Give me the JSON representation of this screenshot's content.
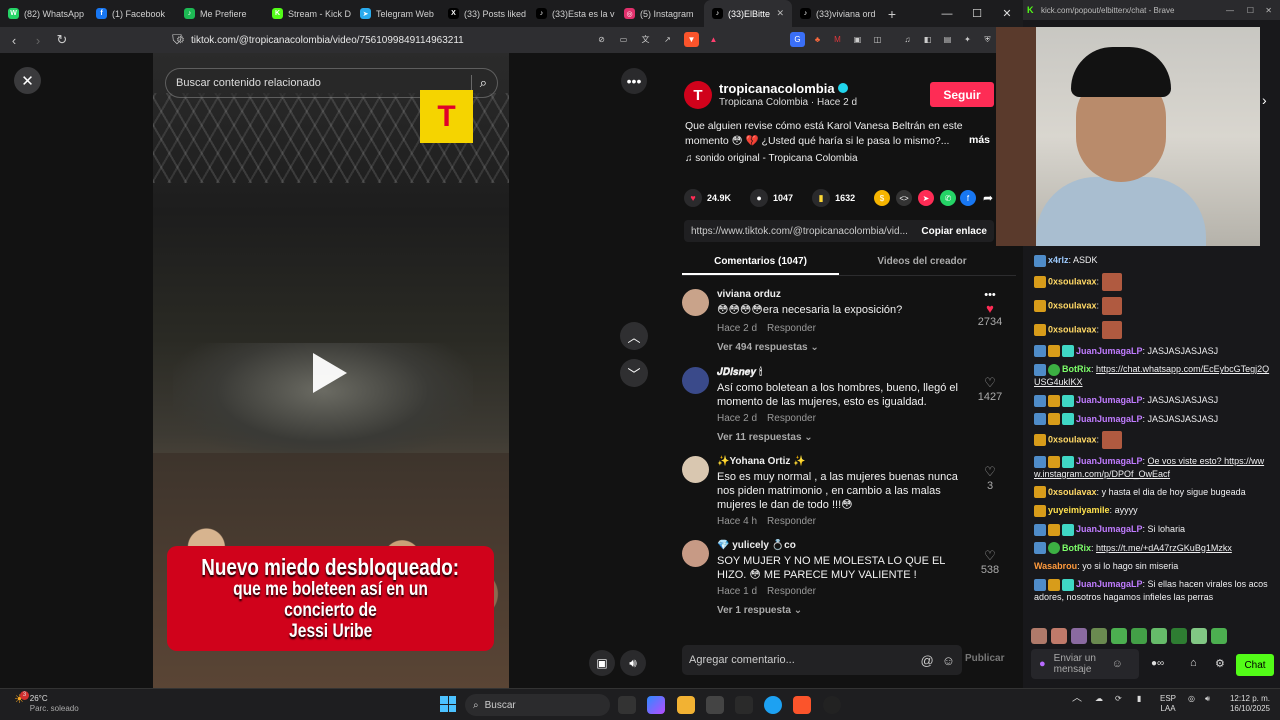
{
  "browser": {
    "tabs": [
      {
        "label": "(82) WhatsApp",
        "color": "#25d366",
        "glyph": "W"
      },
      {
        "label": "(1) Facebook",
        "color": "#1877f2",
        "glyph": "f"
      },
      {
        "label": "Me Prefiere",
        "color": "#1db954",
        "glyph": "♪"
      },
      {
        "label": "Stream - Kick D",
        "color": "#53fc18",
        "glyph": "K"
      },
      {
        "label": "Telegram Web",
        "color": "#2aabee",
        "glyph": "➤"
      },
      {
        "label": "(33) Posts liked",
        "color": "#000000",
        "glyph": "X"
      },
      {
        "label": "(33)Esta es la v",
        "color": "#000000",
        "glyph": "♪"
      },
      {
        "label": "(5) Instagram",
        "color": "#e1306c",
        "glyph": "◎"
      },
      {
        "label": "(33)ElBitte",
        "color": "#000000",
        "glyph": "♪"
      },
      {
        "label": "(33)viviana ord",
        "color": "#000000",
        "glyph": "♪"
      }
    ],
    "url": "tiktok.com/@tropicanacolombia/video/7561099849114963211"
  },
  "video": {
    "search_placeholder": "Buscar contenido relacionado",
    "logo_letter": "T",
    "caption_line1": "Nuevo miedo desbloqueado:",
    "caption_line2": "que me boleteen así en un concierto de",
    "caption_line3": "Jessi Uribe"
  },
  "post": {
    "avatar_letter": "T",
    "username": "tropicanacolombia",
    "subtitle": "Tropicana Colombia · Hace 2 d",
    "follow_label": "Seguir",
    "description": "Que alguien revise cómo está Karol Vanesa Beltrán en este momento 😳 💔 ¿Usted qué haría si le pasa lo mismo?...",
    "more_label": "más",
    "sound": "♫  sonido original - Tropicana Colombia",
    "likes": "24.9K",
    "comments": "1047",
    "saves": "1632",
    "link": "https://www.tiktok.com/@tropicanacolombia/vid...",
    "copy_label": "Copiar enlace",
    "tab_comments": "Comentarios (1047)",
    "tab_videos": "Videos del creador",
    "comment_placeholder": "Agregar comentario...",
    "publish_label": "Publicar"
  },
  "comments": [
    {
      "name": "viviana orduz",
      "text": "😳😳😳😳era necesaria la exposición?",
      "time": "Hace 2 d",
      "reply": "Responder",
      "replies": "Ver 494 respuestas ⌄",
      "likes": "2734",
      "liked": true,
      "avatar": "#c9a38a"
    },
    {
      "name": "𝑱𝑫𝒊𝒔𝒏𝒆𝒚 🕯",
      "text": "Así como boletean a los hombres, bueno, llegó el momento de las mujeres, esto es igualdad.",
      "time": "Hace 2 d",
      "reply": "Responder",
      "replies": "Ver 11 respuestas ⌄",
      "likes": "1427",
      "liked": false,
      "avatar": "#3a4a8a"
    },
    {
      "name": "✨Yohana Ortiz ✨",
      "text": "Eso es muy normal , a las mujeres buenas nunca nos piden matrimonio , en cambio a las malas mujeres le dan de todo !!!😳",
      "time": "Hace 4 h",
      "reply": "Responder",
      "replies": "",
      "likes": "3",
      "liked": false,
      "avatar": "#d9c7b0"
    },
    {
      "name": "💎 yulicely 💍co",
      "text": "SOY MUJER Y NO ME MOLESTA LO QUE EL HIZO. 😳 ME PARECE MUY VALIENTE !",
      "time": "Hace 1 d",
      "reply": "Responder",
      "replies": "Ver 1 respuesta ⌄",
      "likes": "538",
      "liked": false,
      "avatar": "#c79a85"
    }
  ],
  "chat": {
    "window_title": "kick.com/popout/elbitterx/chat - Brave",
    "messages": [
      {
        "nick": "x4rlz",
        "color": "#9ecbff",
        "badges": [
          "b-blue"
        ],
        "text": "ASDK"
      },
      {
        "nick": "0xsoulavax",
        "color": "#ffd866",
        "badges": [
          "b-gold"
        ],
        "emote": true,
        "text": ""
      },
      {
        "nick": "0xsoulavax",
        "color": "#ffd866",
        "badges": [
          "b-gold"
        ],
        "emote": true,
        "text": ""
      },
      {
        "nick": "0xsoulavax",
        "color": "#ffd866",
        "badges": [
          "b-gold"
        ],
        "emote": true,
        "text": ""
      },
      {
        "nick": "JuanJumagaLP",
        "color": "#c07cff",
        "badges": [
          "b-blue",
          "b-gold",
          "b-cyan"
        ],
        "text": "JASJASJASJASJ"
      },
      {
        "nick": "BotRix",
        "color": "#7dff6a",
        "badges": [
          "b-blue",
          "b-green"
        ],
        "text": "https://chat.whatsapp.com/EcEybcGTegj2QUSG4ukIKX",
        "link": true
      },
      {
        "nick": "JuanJumagaLP",
        "color": "#c07cff",
        "badges": [
          "b-blue",
          "b-gold",
          "b-cyan"
        ],
        "text": "JASJASJASJASJ"
      },
      {
        "nick": "JuanJumagaLP",
        "color": "#c07cff",
        "badges": [
          "b-blue",
          "b-gold",
          "b-cyan"
        ],
        "text": "JASJASJASJASJ"
      },
      {
        "nick": "0xsoulavax",
        "color": "#ffd866",
        "badges": [
          "b-gold"
        ],
        "emote": true,
        "text": ""
      },
      {
        "nick": "JuanJumagaLP",
        "color": "#c07cff",
        "badges": [
          "b-blue",
          "b-gold",
          "b-cyan"
        ],
        "text": "Oe vos viste esto? https://www.instagram.com/p/DPOf_OwEacf",
        "link": true
      },
      {
        "nick": "0xsoulavax",
        "color": "#ffd866",
        "badges": [
          "b-gold"
        ],
        "text": "y hasta el dia de hoy sigue bugeada"
      },
      {
        "nick": "yuyeimiyamile",
        "color": "#ffe14d",
        "badges": [
          "b-gold"
        ],
        "text": "ayyyy"
      },
      {
        "nick": "JuanJumagaLP",
        "color": "#c07cff",
        "badges": [
          "b-blue",
          "b-gold",
          "b-cyan"
        ],
        "text": "Si loharia"
      },
      {
        "nick": "BotRix",
        "color": "#7dff6a",
        "badges": [
          "b-blue",
          "b-green"
        ],
        "text": "https://t.me/+dA47rzGKuBg1Mzkx",
        "link": true
      },
      {
        "nick": "Wasabrou",
        "color": "#ff9a3c",
        "badges": [],
        "text": "yo si lo hago sin miseria"
      },
      {
        "nick": "JuanJumagaLP",
        "color": "#c07cff",
        "badges": [
          "b-blue",
          "b-gold",
          "b-cyan"
        ],
        "text": "Si ellas hacen virales los acosadores, nosotros hagamos infieles las perras"
      }
    ],
    "input_placeholder": "Enviar un mensaje",
    "send_label": "Chat"
  },
  "taskbar": {
    "temp": "26°C",
    "weather": "Parc. soleado",
    "search": "Buscar",
    "lang1": "ESP",
    "lang2": "LAA",
    "time": "12:12 p. m.",
    "date": "16/10/2025",
    "notif_count": "3"
  }
}
